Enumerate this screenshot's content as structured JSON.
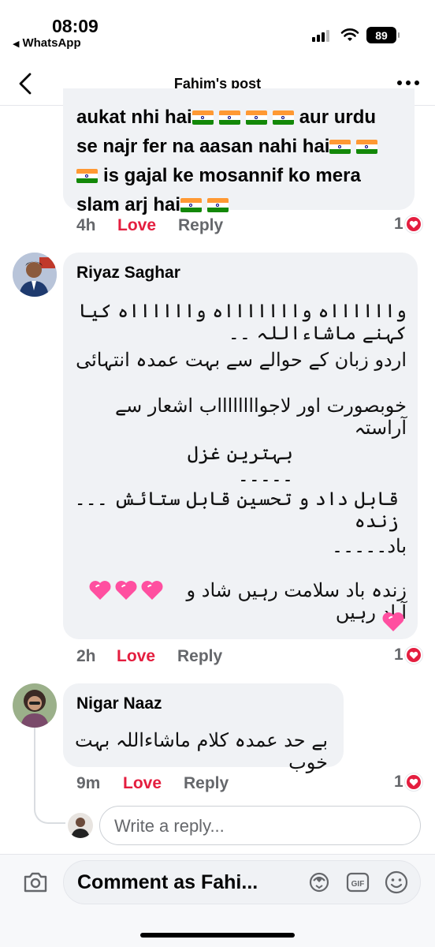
{
  "status_bar": {
    "time": "08:09",
    "back_app": "WhatsApp",
    "battery": "89"
  },
  "header": {
    "title": "Fahim's post"
  },
  "comment_1": {
    "text_lines": [
      "aukat nhi hai",
      "aur urdu",
      "se najr fer na  aasan nahi hai",
      "is gajal ke mosannif ko mera",
      "slam arj hai"
    ],
    "time": "4h",
    "love": "Love",
    "reply": "Reply",
    "reaction_count": "1"
  },
  "comment_2": {
    "author": "Riyaz Saghar",
    "lines": [
      "وااااااہ واااااااہ وااااااہ کیا کہنے ماشاءاللہ ۔۔",
      "اردو زبان کے حوالے سے بہت عمدہ انتہائی",
      "خوبصورت اور لاجوااااااااب اشعار سے آراستہ",
      "بہترین غزل ۔۔۔۔۔",
      "قابل داد و تحسین قابل ستائش ۔۔۔زندہ",
      "باد۔۔۔۔۔",
      "زندہ باد سلامت رہیں شاد و آباد رہیں"
    ],
    "time": "2h",
    "love": "Love",
    "reply": "Reply",
    "reaction_count": "1"
  },
  "comment_3": {
    "author": "Nigar Naaz",
    "text": "بے حد عمدہ کلام ماشاءاللہ بہت خوب",
    "time": "9m",
    "love": "Love",
    "reply": "Reply",
    "reaction_count": "1"
  },
  "reply_input": {
    "placeholder": "Write a reply..."
  },
  "comment_input": {
    "placeholder": "Comment as Fahi..."
  },
  "colors": {
    "love": "#e41e3f",
    "meta_gray": "#65676b",
    "bubble": "#f0f2f5",
    "heart_pink": "#ff4fa0"
  }
}
